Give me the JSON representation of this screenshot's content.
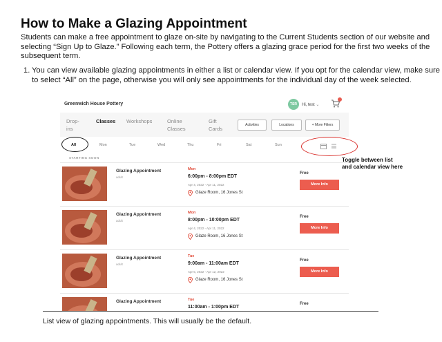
{
  "title": "How to Make a Glazing Appointment",
  "intro": "Students can make a free appointment to glaze on-site by navigating to the Current Students section of our website and selecting “Sign Up to Glaze.” Following each term, the Pottery offers a glazing grace period for the first two weeks of the subsequent term.",
  "steps": [
    {
      "number": "1.",
      "text": "You can view available glazing appointments in either a list or calendar view. If you opt for the calendar view, make sure to select “All” on the page, otherwise you will only see appointments for the individual day of the week selected."
    }
  ],
  "screenshot": {
    "brand": "Greenwich House Pottery",
    "user": {
      "initials": "TSR",
      "greeting": "Hi, test"
    },
    "nav_tabs": [
      {
        "label": "Drop-\nins",
        "active": false
      },
      {
        "label": "Classes",
        "active": true
      },
      {
        "label": "Workshops",
        "active": false
      },
      {
        "label": "Online\nClasses",
        "active": false
      },
      {
        "label": "Gift\nCards",
        "active": false
      }
    ],
    "nav_buttons": [
      "Activities",
      "Locations",
      "+ More Filters"
    ],
    "days": [
      "All",
      "Mon",
      "Tue",
      "Wed",
      "Thu",
      "Fri",
      "Sat",
      "Sun"
    ],
    "active_day": "All",
    "section_label": "STARTING SOON",
    "appointments": [
      {
        "title": "Glazing Appointment",
        "audience": "adult",
        "day": "Mon",
        "time": "6:00pm - 8:00pm EDT",
        "dates": "Apr 4, 2022 - Apr 11, 2022",
        "location": "Glaze Room, 16 Jones St",
        "price": "Free",
        "button": "More Info"
      },
      {
        "title": "Glazing Appointment",
        "audience": "adult",
        "day": "Mon",
        "time": "8:00pm - 10:00pm EDT",
        "dates": "Apr 4, 2022 - Apr 11, 2022",
        "location": "Glaze Room, 16 Jones St",
        "price": "Free",
        "button": "More Info"
      },
      {
        "title": "Glazing Appointment",
        "audience": "adult",
        "day": "Tue",
        "time": "9:00am - 11:00am EDT",
        "dates": "Apr 5, 2022 - Apr 12, 2022",
        "location": "Glaze Room, 16 Jones St",
        "price": "Free",
        "button": "More Info"
      },
      {
        "title": "Glazing Appointment",
        "audience": "",
        "day": "Tue",
        "time": "11:00am - 1:00pm EDT",
        "dates": "",
        "location": "",
        "price": "Free",
        "button": ""
      }
    ]
  },
  "annotation": "Toggle between list\nand calendar view here",
  "caption": "List view of glazing appointments. This will usually be the default.",
  "colors": {
    "accent": "#ec5d4f",
    "annotation_oval": "#d9302c",
    "avatar": "#7ec9a1"
  }
}
